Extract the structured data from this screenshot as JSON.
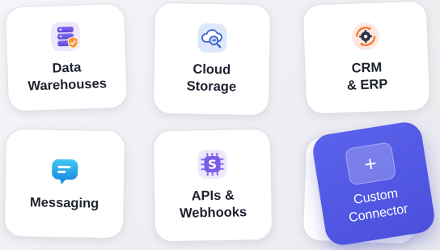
{
  "cards": [
    {
      "label": "Data\nWarehouses",
      "icon": "database-shield-icon"
    },
    {
      "label": "Cloud\nStorage",
      "icon": "cloud-search-icon"
    },
    {
      "label": "CRM\n& ERP",
      "icon": "gear-sync-icon"
    },
    {
      "label": "Messaging",
      "icon": "chat-bubble-icon"
    },
    {
      "label": "APIs &\nWebhooks",
      "icon": "chip-s-icon"
    }
  ],
  "custom": {
    "label": "Custom\nConnector",
    "icon": "plus-icon",
    "symbol": "+"
  },
  "colors": {
    "accent": "#4f55e3",
    "card_bg": "#ffffff",
    "text": "#1f2230"
  }
}
